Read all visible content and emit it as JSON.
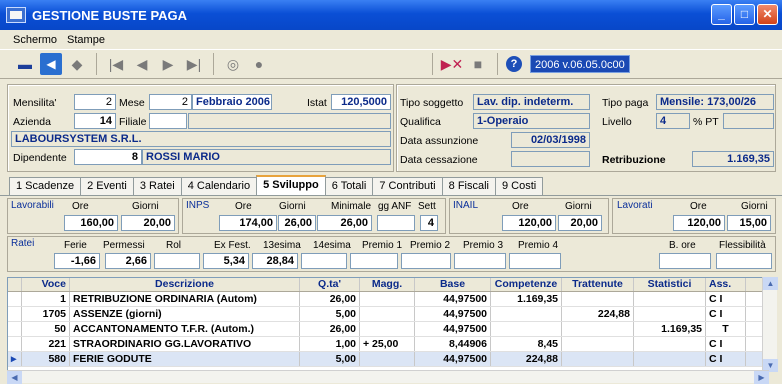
{
  "window": {
    "title": "GESTIONE BUSTE PAGA",
    "minimize": "_",
    "restore": "□",
    "close": "✕"
  },
  "menu": [
    "Schermo",
    "Stampe"
  ],
  "toolbar": {
    "version": "2006 v.06.05.0c00"
  },
  "header": {
    "mensilita_label": "Mensilita'",
    "mensilita": "2",
    "mese_label": "Mese",
    "mese_num": "2",
    "mese_name": "Febbraio  2006",
    "istat_label": "Istat",
    "istat": "120,5000",
    "azienda_label": "Azienda",
    "azienda": "14",
    "filiale_label": "Filiale",
    "filiale": "",
    "filiale_desc": "",
    "company": "LABOURSYSTEM S.R.L.",
    "dipendente_label": "Dipendente",
    "dipendente_num": "8",
    "dipendente_name": "ROSSI MARIO",
    "tipo_soggetto_label": "Tipo soggetto",
    "tipo_soggetto": "Lav. dip. indeterm.",
    "tipo_paga_label": "Tipo paga",
    "tipo_paga": "Mensile: 173,00/26",
    "qualifica_label": "Qualifica",
    "qualifica": "1-Operaio",
    "livello_label": "Livello",
    "livello": "4",
    "pt_label": "% PT",
    "pt": "",
    "assunzione_label": "Data assunzione",
    "assunzione": "02/03/1998",
    "cessazione_label": "Data cessazione",
    "cessazione": "",
    "retribuzione_label": "Retribuzione",
    "retribuzione": "1.169,35"
  },
  "tabs": [
    "1 Scadenze",
    "2 Eventi",
    "3 Ratei",
    "4 Calendario",
    "5 Sviluppo",
    "6 Totali",
    "7 Contributi",
    "8 Fiscali",
    "9 Costi"
  ],
  "sviluppo": {
    "lavorabili": {
      "label": "Lavorabili",
      "ore_label": "Ore",
      "ore": "160,00",
      "giorni_label": "Giorni",
      "giorni": "20,00"
    },
    "inps": {
      "label": "INPS",
      "ore_label": "Ore",
      "ore": "174,00",
      "giorni_label": "Giorni",
      "giorni": "26,00",
      "minimale_label": "Minimale",
      "minimale": "26,00",
      "gganf_label": "gg ANF",
      "gganf": "",
      "sett_label": "Sett",
      "sett": "4"
    },
    "inail": {
      "label": "INAIL",
      "ore_label": "Ore",
      "ore": "120,00",
      "giorni_label": "Giorni",
      "giorni": "20,00"
    },
    "lavorati": {
      "label": "Lavorati",
      "ore_label": "Ore",
      "ore": "120,00",
      "giorni_label": "Giorni",
      "giorni": "15,00"
    },
    "ratei": {
      "label": "Ratei",
      "ferie_label": "Ferie",
      "ferie": "-1,66",
      "permessi_label": "Permessi",
      "permessi": "2,66",
      "rol_label": "Rol",
      "rol": "",
      "exfest_label": "Ex Fest.",
      "exfest": "5,34",
      "tredicesima_label": "13esima",
      "tredicesima": "28,84",
      "quattordicesima_label": "14esima",
      "quattordicesima": "",
      "premio1_label": "Premio 1",
      "premio1": "",
      "premio2_label": "Premio 2",
      "premio2": "",
      "premio3_label": "Premio 3",
      "premio3": "",
      "premio4_label": "Premio 4",
      "premio4": "",
      "bore_label": "B. ore",
      "bore": "",
      "flessibilita_label": "Flessibilità",
      "flessibilita": ""
    }
  },
  "grid": {
    "columns": [
      "Voce",
      "Descrizione",
      "Q.ta'",
      "Magg.",
      "Base",
      "Competenze",
      "Trattenute",
      "Statistici",
      "Ass."
    ],
    "rows": [
      {
        "voce": "1",
        "descr": "RETRIBUZIONE ORDINARIA (Autom)",
        "qta": "26,00",
        "magg": "",
        "base": "44,97500",
        "comp": "1.169,35",
        "tratt": "",
        "stat": "",
        "ass": "C I"
      },
      {
        "voce": "1705",
        "descr": "ASSENZE (giorni)",
        "qta": "5,00",
        "magg": "",
        "base": "44,97500",
        "comp": "",
        "tratt": "224,88",
        "stat": "",
        "ass": "C I"
      },
      {
        "voce": "50",
        "descr": "ACCANTONAMENTO T.F.R. (Autom.)",
        "qta": "26,00",
        "magg": "",
        "base": "44,97500",
        "comp": "",
        "tratt": "",
        "stat": "1.169,35",
        "ass": "T"
      },
      {
        "voce": "221",
        "descr": "STRAORDINARIO GG.LAVORATIVO",
        "qta": "1,00",
        "magg": "+ 25,00",
        "base": "8,44906",
        "comp": "8,45",
        "tratt": "",
        "stat": "",
        "ass": "C I"
      },
      {
        "voce": "580",
        "descr": "FERIE GODUTE",
        "qta": "5,00",
        "magg": "",
        "base": "44,97500",
        "comp": "224,88",
        "tratt": "",
        "stat": "",
        "ass": "C I"
      }
    ]
  }
}
